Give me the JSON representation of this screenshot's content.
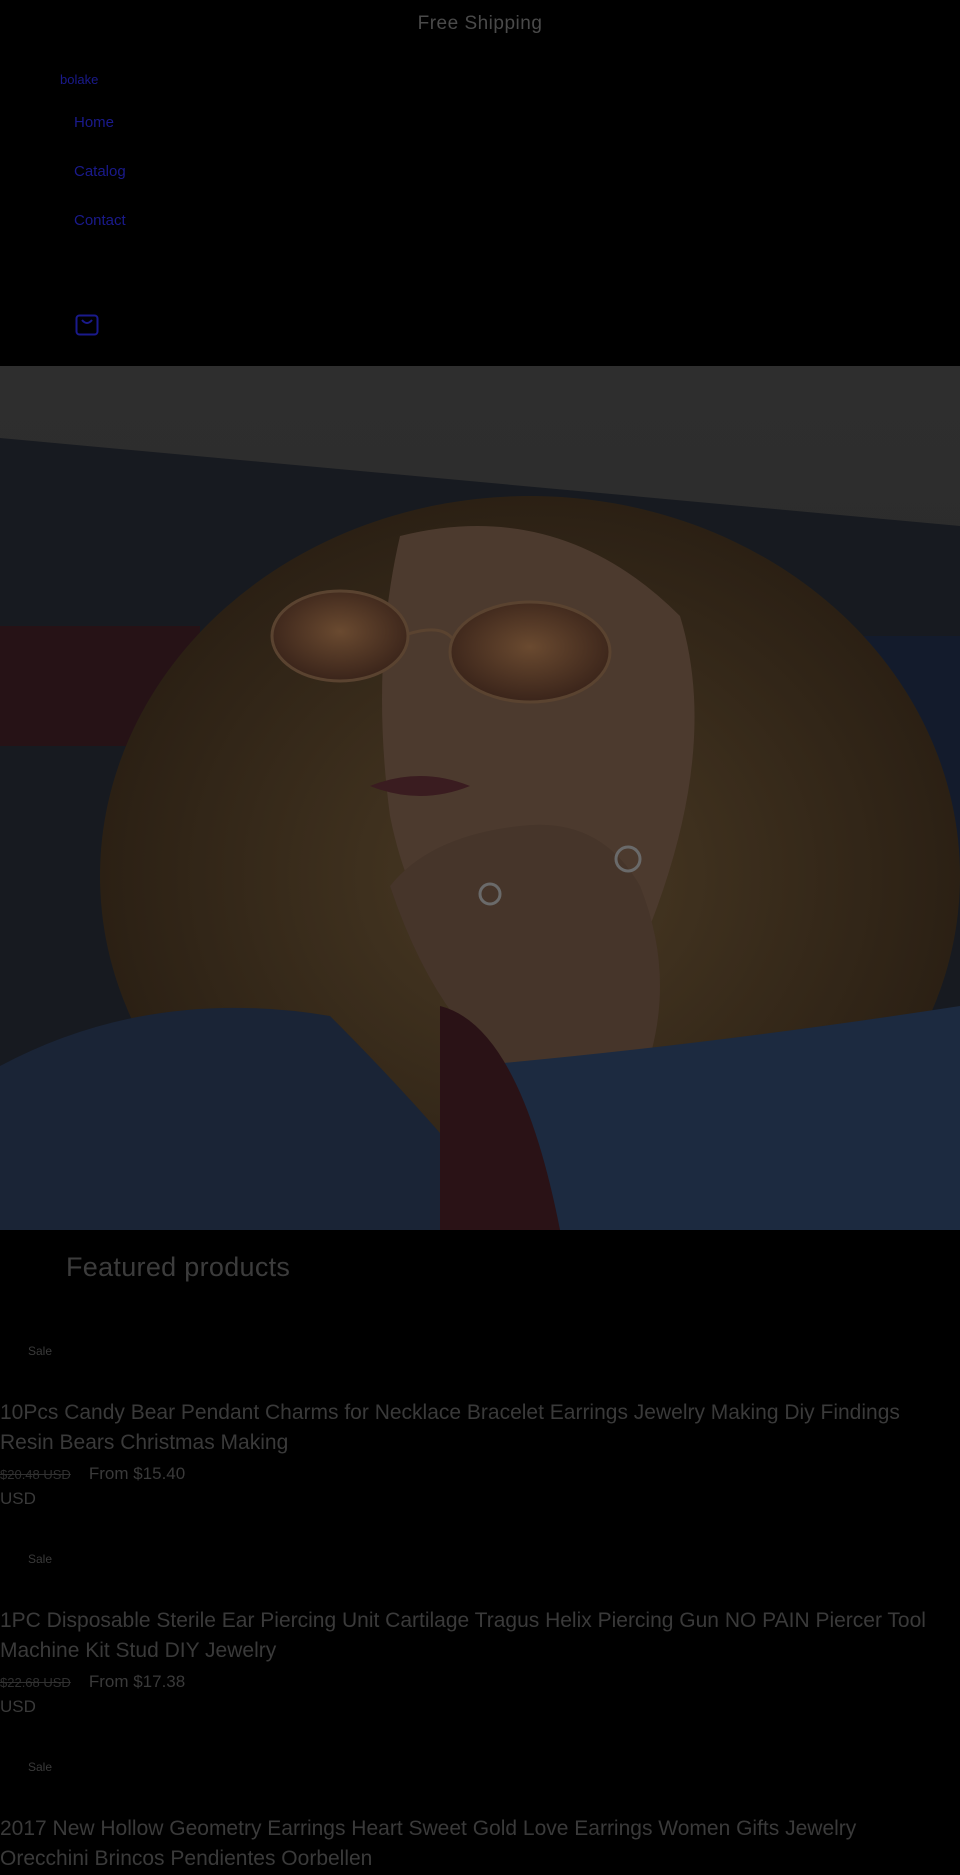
{
  "announcement": {
    "text": "Free Shipping"
  },
  "header": {
    "brand": "bolake",
    "nav": [
      {
        "label": "Home"
      },
      {
        "label": "Catalog"
      },
      {
        "label": "Contact"
      }
    ],
    "cart_icon": "bag-icon"
  },
  "hero": {
    "image": "woman-sunglasses-photo"
  },
  "featured": {
    "title": "Featured products",
    "products": [
      {
        "badge": "Sale",
        "title": "10Pcs Candy Bear Pendant Charms for Necklace Bracelet Earrings Jewelry Making Diy Findings Resin Bears Christmas Making",
        "old_price": "$20.48 USD",
        "price": "From $15.40",
        "currency": "USD"
      },
      {
        "badge": "Sale",
        "title": "1PC Disposable Sterile Ear Piercing Unit Cartilage Tragus Helix Piercing Gun NO PAIN Piercer Tool Machine Kit Stud DIY Jewelry",
        "old_price": "$22.68 USD",
        "price": "From $17.38",
        "currency": "USD"
      },
      {
        "badge": "Sale",
        "title": "2017 New Hollow Geometry Earrings Heart Sweet Gold Love Earrings Women Gifts Jewelry Orecchini Brincos Pendientes Oorbellen"
      }
    ]
  },
  "colors": {
    "background": "#000000",
    "link": "#1a1a8c",
    "text": "#3a3a3a"
  }
}
